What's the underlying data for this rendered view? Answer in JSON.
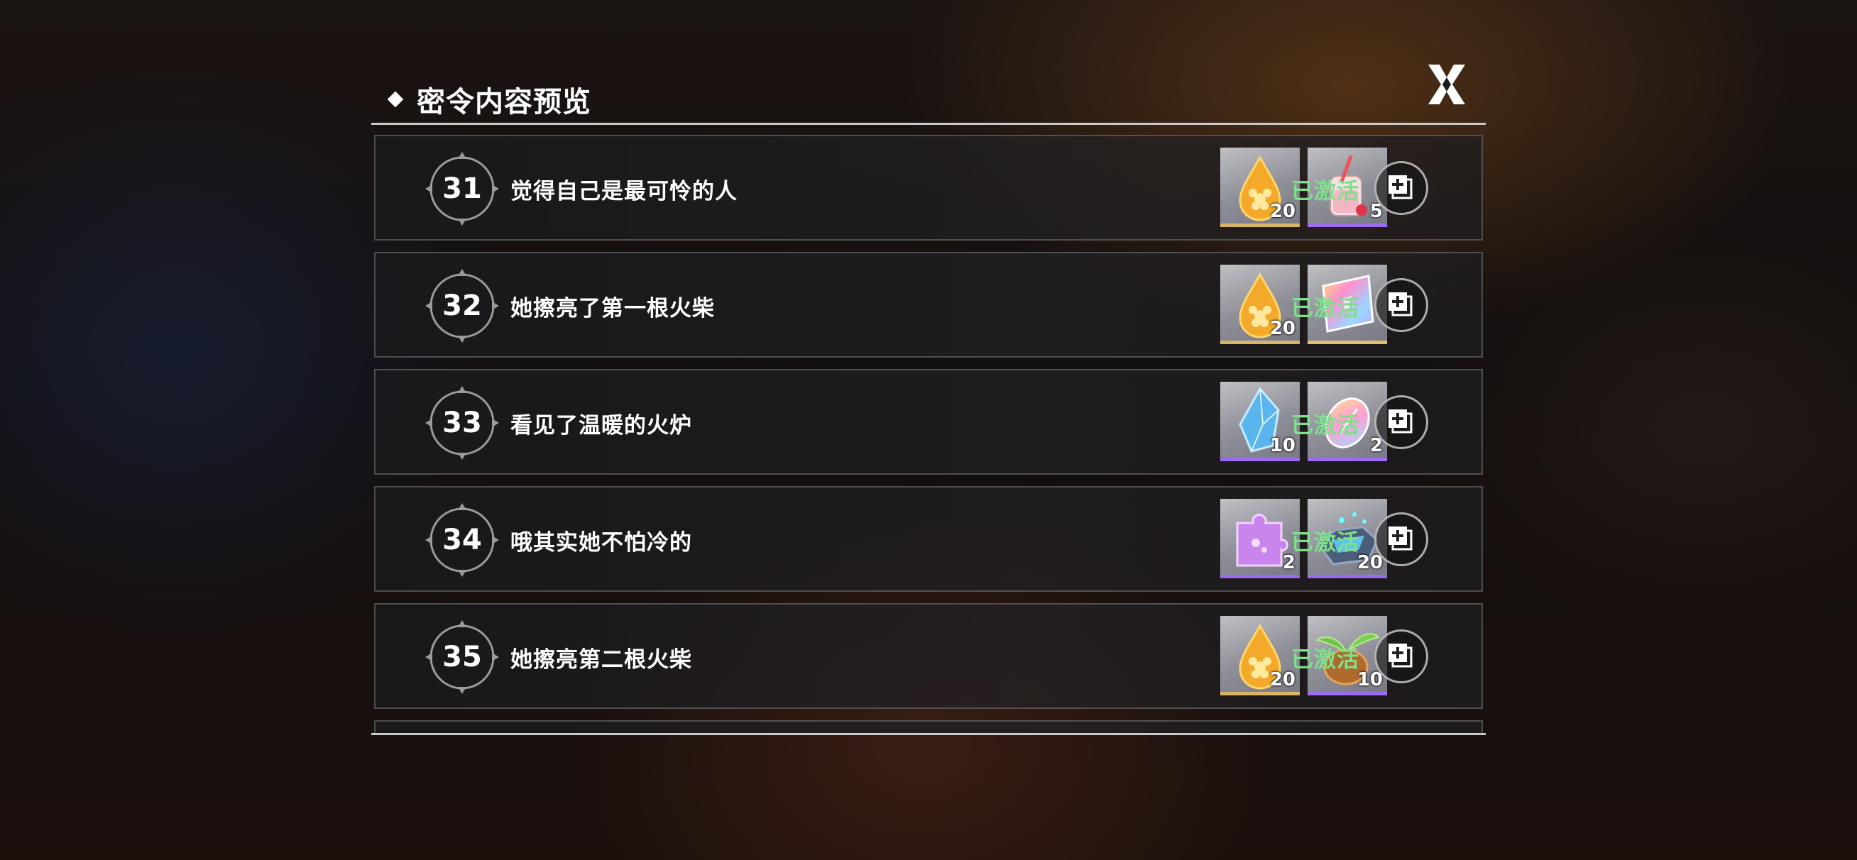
{
  "dialog": {
    "title": "密令内容预览",
    "close_icon": "close-x-icon"
  },
  "rows": [
    {
      "number": "31",
      "title": "觉得自己是最可怜的人",
      "status": "已激活",
      "rewards": [
        {
          "icon": "golden-droplet-icon",
          "qty": "20",
          "rarity": "gold"
        },
        {
          "icon": "strawberry-drink-jar-icon",
          "qty": "5",
          "rarity": "purple"
        }
      ]
    },
    {
      "number": "32",
      "title": "她擦亮了第一根火柴",
      "status": "已激活",
      "rewards": [
        {
          "icon": "golden-droplet-icon",
          "qty": "20",
          "rarity": "gold"
        },
        {
          "icon": "rainbow-card-icon",
          "qty": "",
          "rarity": "gold"
        }
      ]
    },
    {
      "number": "33",
      "title": "看见了温暖的火炉",
      "status": "已激活",
      "rewards": [
        {
          "icon": "blue-crystal-icon",
          "qty": "10",
          "rarity": "purple"
        },
        {
          "icon": "rainbow-feather-egg-icon",
          "qty": "2",
          "rarity": "purple"
        }
      ]
    },
    {
      "number": "34",
      "title": "哦其实她不怕冷的",
      "status": "已激活",
      "rewards": [
        {
          "icon": "purple-puzzle-piece-icon",
          "qty": "2",
          "rarity": "purple"
        },
        {
          "icon": "glowing-ore-icon",
          "qty": "20",
          "rarity": "purple"
        }
      ]
    },
    {
      "number": "35",
      "title": "她擦亮第二根火柴",
      "status": "已激活",
      "rewards": [
        {
          "icon": "golden-droplet-icon",
          "qty": "20",
          "rarity": "gold"
        },
        {
          "icon": "sprouting-seed-icon",
          "qty": "10",
          "rarity": "purple"
        }
      ]
    }
  ],
  "colors": {
    "status_active": "#7fe08c",
    "gold_rarity": "#d9b566",
    "purple_rarity": "#9c6cf0"
  }
}
